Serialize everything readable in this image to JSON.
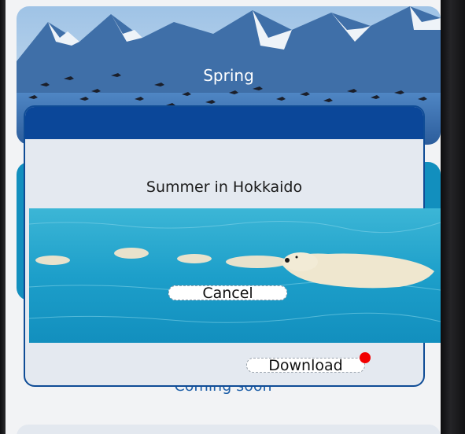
{
  "cards": {
    "spring": {
      "label": "Spring"
    },
    "coming_soon": "Coming soon"
  },
  "dialog": {
    "title": "Summer in Hokkaido",
    "cancel_label": "Cancel",
    "download_label": "Download",
    "badge_color": "#f20000",
    "header_color": "#0b4799"
  },
  "icons": {
    "spring_image": "mountains-with-birds-image",
    "summer_image": "polar-bear-swimming-image"
  }
}
